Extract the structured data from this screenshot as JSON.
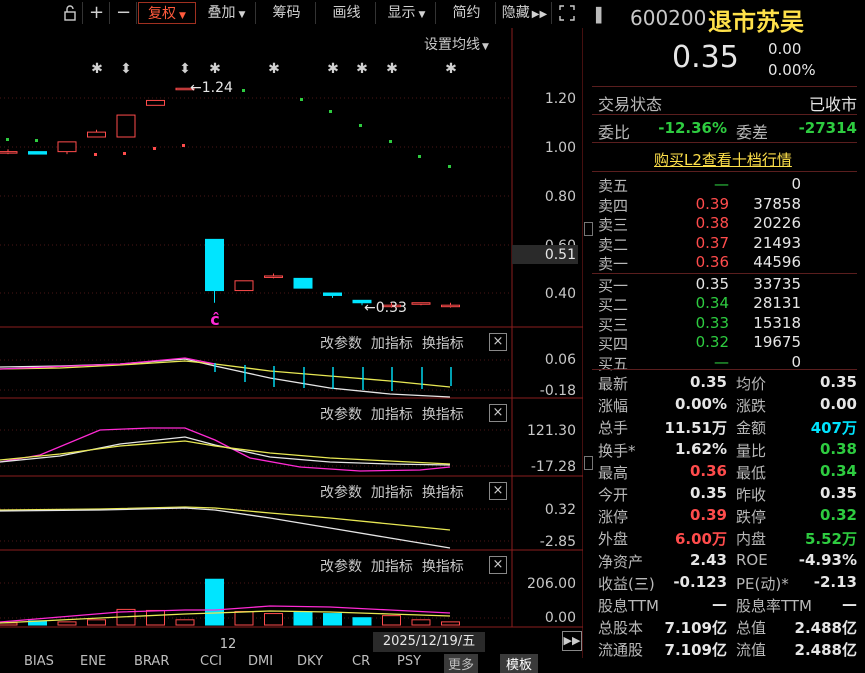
{
  "toolbar": {
    "buttons": [
      "复权",
      "叠加",
      "筹码",
      "画线",
      "显示",
      "简约",
      "隐藏"
    ],
    "setting_ma": "设置均线"
  },
  "header": {
    "code": "600200",
    "name": "退市苏吴",
    "price": "0.35",
    "change": "0.00",
    "change_pct": "0.00%"
  },
  "status": {
    "label": "交易状态",
    "value": "已收市"
  },
  "weibi": {
    "label1": "委比",
    "val1": "-12.36%",
    "label2": "委差",
    "val2": "-27314"
  },
  "l2_link": "购买L2查看十档行情",
  "asks": [
    {
      "label": "卖五",
      "price": "—",
      "vol": "0"
    },
    {
      "label": "卖四",
      "price": "0.39",
      "vol": "37858"
    },
    {
      "label": "卖三",
      "price": "0.38",
      "vol": "20226"
    },
    {
      "label": "卖二",
      "price": "0.37",
      "vol": "21493"
    },
    {
      "label": "卖一",
      "price": "0.36",
      "vol": "44596"
    }
  ],
  "bids": [
    {
      "label": "买一",
      "price": "0.35",
      "vol": "33735"
    },
    {
      "label": "买二",
      "price": "0.34",
      "vol": "28131"
    },
    {
      "label": "买三",
      "price": "0.33",
      "vol": "15318"
    },
    {
      "label": "买四",
      "price": "0.32",
      "vol": "19675"
    },
    {
      "label": "买五",
      "price": "—",
      "vol": "0"
    }
  ],
  "stats": [
    {
      "l1": "最新",
      "v1": "0.35",
      "c1": "wht",
      "l2": "均价",
      "v2": "0.35",
      "c2": "wht"
    },
    {
      "l1": "涨幅",
      "v1": "0.00%",
      "c1": "wht",
      "l2": "涨跌",
      "v2": "0.00",
      "c2": "wht"
    },
    {
      "l1": "总手",
      "v1": "11.51万",
      "c1": "wht",
      "l2": "金额",
      "v2": "407万",
      "c2": "cyn"
    },
    {
      "l1": "换手*",
      "v1": "1.62%",
      "c1": "wht",
      "l2": "量比",
      "v2": "0.38",
      "c2": "grn"
    },
    {
      "l1": "最高",
      "v1": "0.36",
      "c1": "red",
      "l2": "最低",
      "v2": "0.34",
      "c2": "grn"
    },
    {
      "l1": "今开",
      "v1": "0.35",
      "c1": "wht",
      "l2": "昨收",
      "v2": "0.35",
      "c2": "wht"
    },
    {
      "l1": "涨停",
      "v1": "0.39",
      "c1": "red",
      "l2": "跌停",
      "v2": "0.32",
      "c2": "grn"
    },
    {
      "l1": "外盘",
      "v1": "6.00万",
      "c1": "red",
      "l2": "内盘",
      "v2": "5.52万",
      "c2": "grn"
    },
    {
      "l1": "净资产",
      "v1": "2.43",
      "c1": "wht",
      "l2": "ROE",
      "v2": "-4.93%",
      "c2": "wht"
    },
    {
      "l1": "收益(㆔)",
      "v1": "-0.123",
      "c1": "wht",
      "l2": "PE(动)*",
      "v2": "-2.13",
      "c2": "wht"
    },
    {
      "l1": "股息TTM",
      "v1": "—",
      "c1": "wht",
      "l2": "股息率TTM",
      "v2": "—",
      "c2": "wht"
    },
    {
      "l1": "总股本",
      "v1": "7.109亿",
      "c1": "wht",
      "l2": "总值",
      "v2": "2.488亿",
      "c2": "wht"
    },
    {
      "l1": "流通股",
      "v1": "7.109亿",
      "c1": "wht",
      "l2": "流值",
      "v2": "2.488亿",
      "c2": "wht"
    }
  ],
  "indicator_tabs": [
    "BIAS",
    "ENE",
    "BRAR",
    "CCI",
    "DMI",
    "DKY",
    "CR",
    "PSY",
    "更多",
    "模板"
  ],
  "panel_buttons": [
    "改参数",
    "加指标",
    "换指标"
  ],
  "date_label": "2025/12/19/五",
  "x_tick": "12",
  "chart_data": [
    {
      "type": "candlestick",
      "price_ticks": [
        "1.20",
        "1.00",
        "0.80",
        "0.60",
        "0.40"
      ],
      "current_tag": "0.51",
      "high_label": "1.24",
      "low_label": "0.33",
      "candles": [
        {
          "o": 0.98,
          "c": 0.98,
          "h": 0.99,
          "l": 0.97
        },
        {
          "o": 0.98,
          "c": 0.97,
          "h": 0.98,
          "l": 0.97
        },
        {
          "o": 0.98,
          "c": 1.02,
          "h": 1.02,
          "l": 0.97
        },
        {
          "o": 1.04,
          "c": 1.06,
          "h": 1.07,
          "l": 1.04
        },
        {
          "o": 1.04,
          "c": 1.13,
          "h": 1.13,
          "l": 1.04
        },
        {
          "o": 1.17,
          "c": 1.19,
          "h": 1.19,
          "l": 1.17
        },
        {
          "o": 1.24,
          "c": 1.24,
          "h": 1.24,
          "l": 1.24
        },
        {
          "o": 0.62,
          "c": 0.41,
          "h": 0.62,
          "l": 0.36
        },
        {
          "o": 0.41,
          "c": 0.45,
          "h": 0.45,
          "l": 0.41
        },
        {
          "o": 0.47,
          "c": 0.47,
          "h": 0.48,
          "l": 0.46
        },
        {
          "o": 0.46,
          "c": 0.42,
          "h": 0.46,
          "l": 0.42
        },
        {
          "o": 0.4,
          "c": 0.39,
          "h": 0.4,
          "l": 0.38
        },
        {
          "o": 0.37,
          "c": 0.36,
          "h": 0.37,
          "l": 0.35
        },
        {
          "o": 0.35,
          "c": 0.35,
          "h": 0.36,
          "l": 0.34
        },
        {
          "o": 0.36,
          "c": 0.36,
          "h": 0.36,
          "l": 0.35
        },
        {
          "o": 0.35,
          "c": 0.35,
          "h": 0.36,
          "l": 0.34
        }
      ]
    },
    {
      "type": "line",
      "ticks": [
        "0.06",
        "-0.18"
      ]
    },
    {
      "type": "line",
      "ticks": [
        "121.30",
        "-17.28"
      ]
    },
    {
      "type": "line",
      "ticks": [
        "0.32",
        "-2.85"
      ]
    },
    {
      "type": "bar",
      "ticks": [
        "206.00",
        "0.00"
      ]
    }
  ]
}
